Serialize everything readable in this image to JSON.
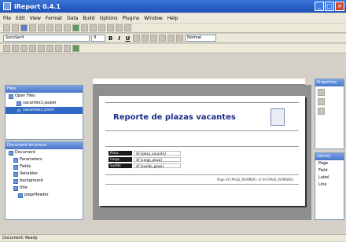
{
  "window": {
    "title": "iReport 0.4.1"
  },
  "menu": [
    "File",
    "Edit",
    "View",
    "Format",
    "Data",
    "Build",
    "Options",
    "Plugins",
    "Window",
    "Help"
  ],
  "toolbar3": {
    "font_combo": "SansSerif",
    "size_combo": "9",
    "zoom_combo": "Normal"
  },
  "files_panel": {
    "title": "Files",
    "items": [
      "Open Files",
      "vacantes1.jasper",
      "vacantes1.jrxml"
    ]
  },
  "structure_panel": {
    "title": "Document structure",
    "items": [
      "Document",
      "Parameters",
      "Fields",
      "Variables",
      "background",
      "title",
      "pageHeader"
    ]
  },
  "report": {
    "title": "Reporte de plazas vacantes",
    "fields": [
      {
        "label": "Plaza",
        "value": "$F{plaza_vacante}"
      },
      {
        "label": "Cargo",
        "value": "$F{cargo_plaza}"
      },
      {
        "label": "Sueldo",
        "value": "$F{sueldo_plaza}"
      }
    ],
    "footer": "Page $V{PAGE_NUMBER} of $V{PAGE_NUMBER}"
  },
  "right_panel": {
    "title": "Properties",
    "lib_title": "Library",
    "items": [
      "Page",
      "Field",
      "Label",
      "Line"
    ]
  },
  "status": {
    "text": "Document: Ready"
  }
}
